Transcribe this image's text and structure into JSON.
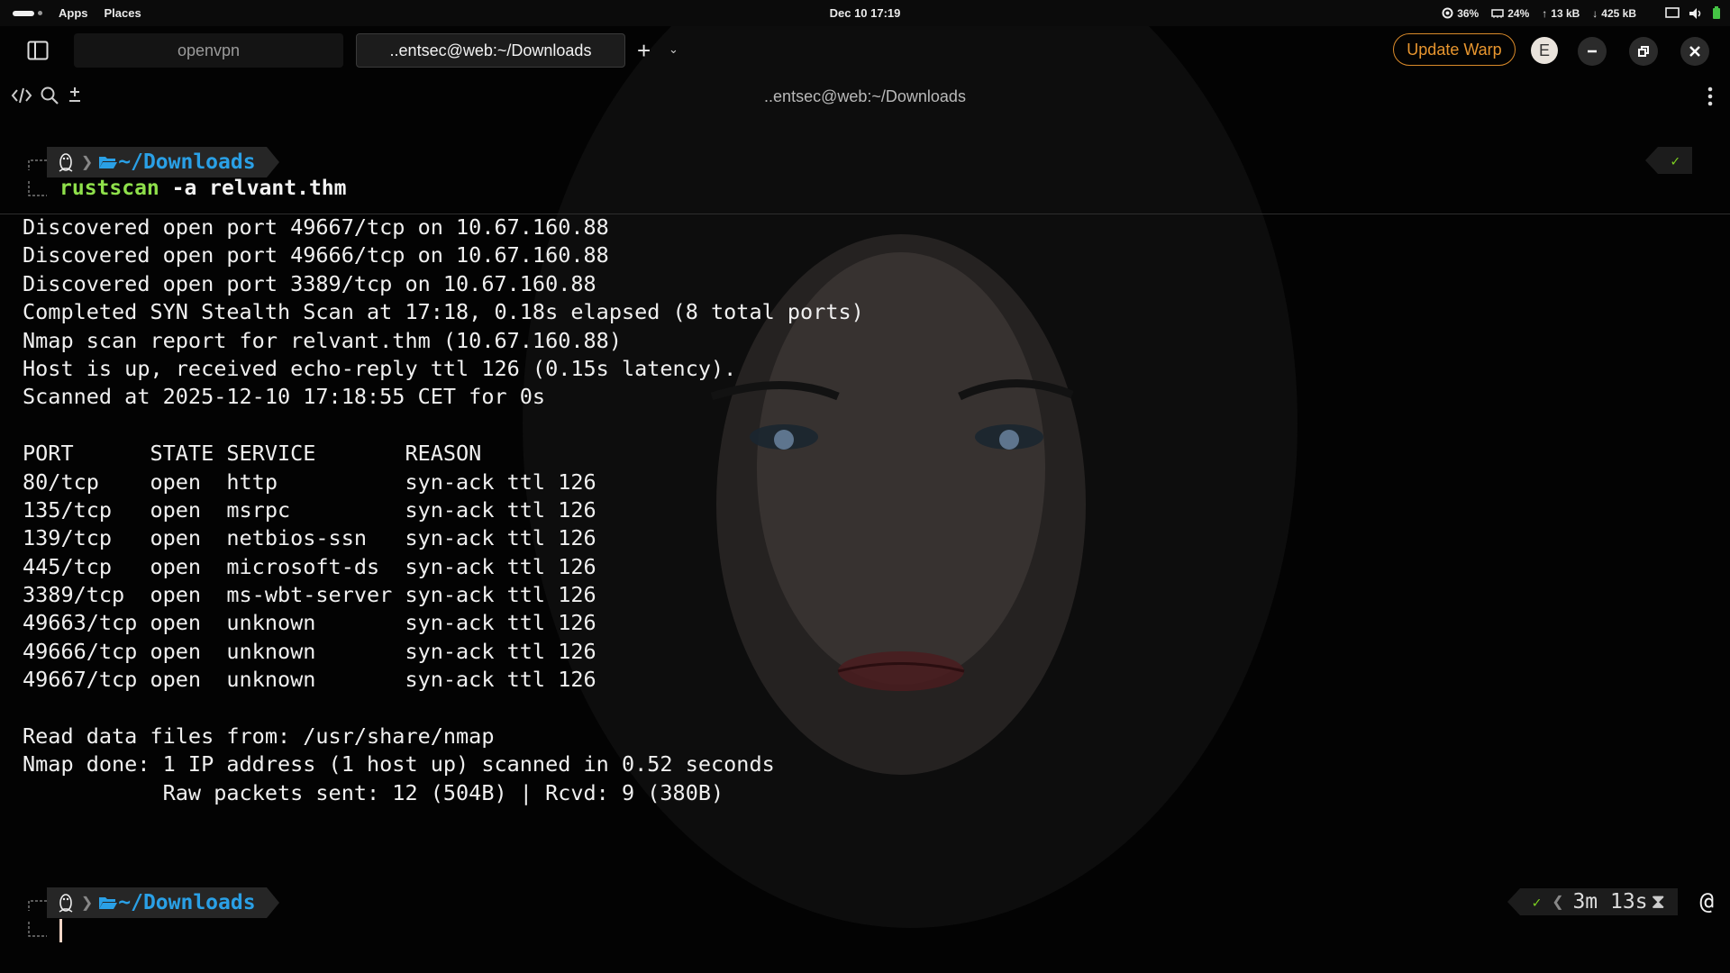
{
  "topbar": {
    "apps_label": "Apps",
    "places_label": "Places",
    "clock": "Dec 10  17:19",
    "cpu": "36%",
    "memory": "24%",
    "upload": "13 kB",
    "download": "425 kB"
  },
  "tabs": {
    "tab1_label": "openvpn",
    "tab2_label": "..entsec@web:~/Downloads",
    "update_label": "Update Warp",
    "avatar_letter": "E"
  },
  "pane": {
    "title": "..entsec@web:~/Downloads"
  },
  "block1": {
    "dir": "~/Downloads",
    "command_name": "rustscan",
    "command_args": " -a relvant.thm",
    "status": "✓"
  },
  "output": [
    "Discovered open port 49667/tcp on 10.67.160.88",
    "Discovered open port 49666/tcp on 10.67.160.88",
    "Discovered open port 3389/tcp on 10.67.160.88",
    "Completed SYN Stealth Scan at 17:18, 0.18s elapsed (8 total ports)",
    "Nmap scan report for relvant.thm (10.67.160.88)",
    "Host is up, received echo-reply ttl 126 (0.15s latency).",
    "Scanned at 2025-12-10 17:18:55 CET for 0s",
    "",
    "PORT      STATE SERVICE       REASON",
    "80/tcp    open  http          syn-ack ttl 126",
    "135/tcp   open  msrpc         syn-ack ttl 126",
    "139/tcp   open  netbios-ssn   syn-ack ttl 126",
    "445/tcp   open  microsoft-ds  syn-ack ttl 126",
    "3389/tcp  open  ms-wbt-server syn-ack ttl 126",
    "49663/tcp open  unknown       syn-ack ttl 126",
    "49666/tcp open  unknown       syn-ack ttl 126",
    "49667/tcp open  unknown       syn-ack ttl 126",
    "",
    "Read data files from: /usr/share/nmap",
    "Nmap done: 1 IP address (1 host up) scanned in 0.52 seconds",
    "           Raw packets sent: 12 (504B) | Rcvd: 9 (380B)"
  ],
  "block2": {
    "dir": "~/Downloads",
    "status": "✓",
    "duration": "3m 13s",
    "at": "@"
  },
  "colors": {
    "dir": "#2aa0e6",
    "command": "#8fe04b",
    "update_accent": "#d98a2a",
    "success": "#7ed321"
  }
}
